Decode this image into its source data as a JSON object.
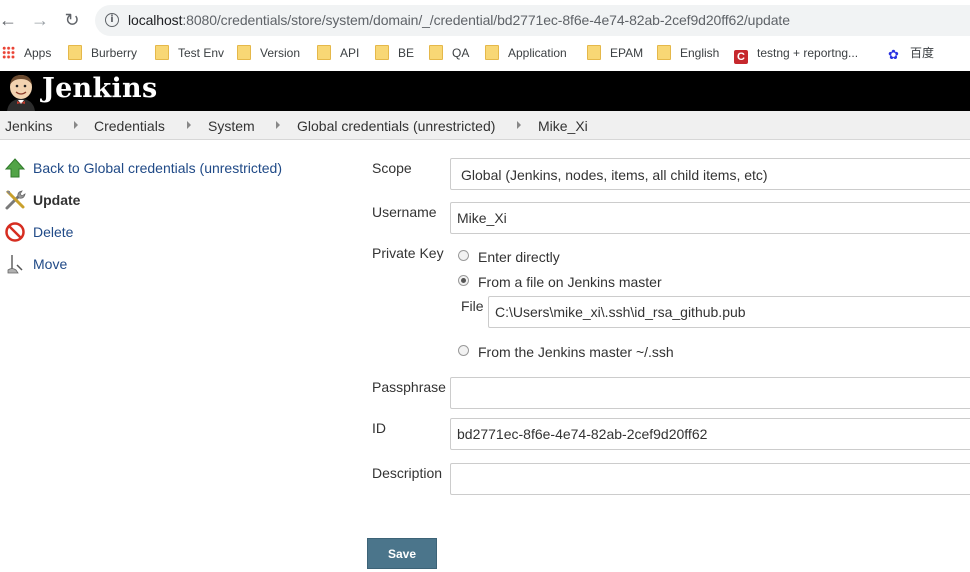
{
  "browser": {
    "url_host": "localhost",
    "url_rest": ":8080/credentials/store/system/domain/_/credential/bd2771ec-8f6e-4e74-82ab-2cef9d20ff62/update",
    "back_glyph": "←",
    "forward_glyph": "→",
    "reload_glyph": "↻",
    "info_glyph": "i",
    "bookmarks": [
      "Apps",
      "Burberry",
      "Test Env",
      "Version",
      "API",
      "BE",
      "QA",
      "Application",
      "EPAM",
      "English",
      "testng + reportng...",
      "百度"
    ]
  },
  "header": {
    "title": "Jenkins"
  },
  "breadcrumb": [
    "Jenkins",
    "Credentials",
    "System",
    "Global credentials (unrestricted)",
    "Mike_Xi"
  ],
  "side_panel": [
    {
      "label": "Back to Global credentials (unrestricted)",
      "icon": "up-arrow-icon"
    },
    {
      "label": "Update",
      "icon": "tools-icon"
    },
    {
      "label": "Delete",
      "icon": "no-entry-icon"
    },
    {
      "label": "Move",
      "icon": "move-icon"
    }
  ],
  "form": {
    "scope_label": "Scope",
    "scope_value": "Global (Jenkins, nodes, items, all child items, etc)",
    "username_label": "Username",
    "username_value": "Mike_Xi",
    "private_key_label": "Private Key",
    "radio_enter": "Enter directly",
    "radio_file": "From a file on Jenkins master",
    "file_label": "File",
    "file_value": "C:\\Users\\mike_xi\\.ssh\\id_rsa_github.pub",
    "radio_ssh": "From the Jenkins master ~/.ssh",
    "passphrase_label": "Passphrase",
    "passphrase_value": "",
    "id_label": "ID",
    "id_value": "bd2771ec-8f6e-4e74-82ab-2cef9d20ff62",
    "description_label": "Description",
    "description_value": "",
    "selected_radio": "From a file on Jenkins master",
    "save_label": "Save"
  },
  "colors": {
    "header_bg": "#000000",
    "link": "#204a87",
    "save_bg": "#4b758b",
    "breadcrumb_bg": "#f0f0f0"
  }
}
